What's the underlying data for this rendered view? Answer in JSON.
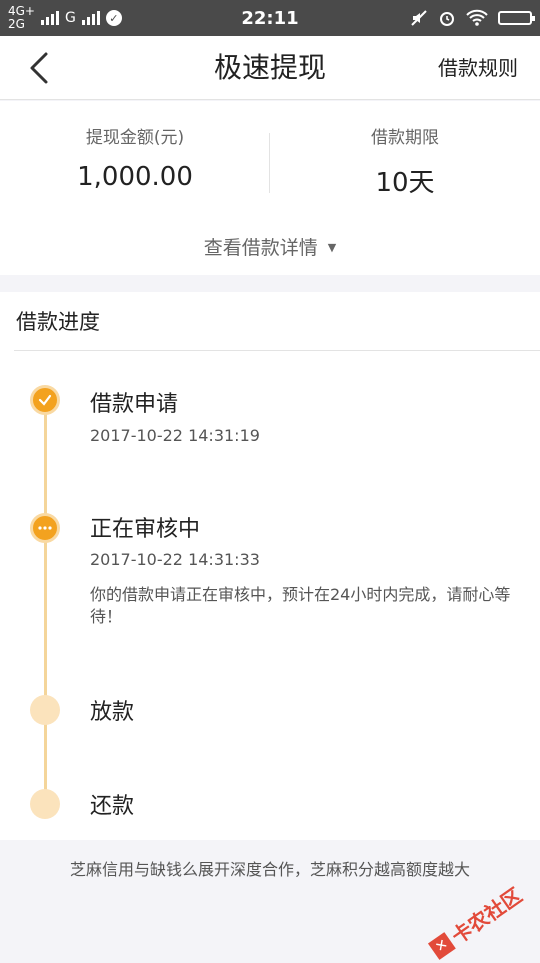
{
  "status_bar": {
    "net_top": "4G+",
    "net_bottom": "2G",
    "carrier": "G",
    "time": "22:11"
  },
  "nav": {
    "title": "极速提现",
    "rules_label": "借款规则"
  },
  "summary": {
    "amount_label": "提现金额(元)",
    "amount_value": "1,000.00",
    "term_label": "借款期限",
    "term_value": "10天",
    "details_link": "查看借款详情"
  },
  "progress": {
    "title": "借款进度",
    "steps": [
      {
        "title": "借款申请",
        "time": "2017-10-22 14:31:19",
        "state": "done"
      },
      {
        "title": "正在审核中",
        "time": "2017-10-22 14:31:33",
        "note": "你的借款申请正在审核中，预计在24小时内完成，请耐心等待！",
        "state": "in-progress"
      },
      {
        "title": "放款",
        "state": "pending"
      },
      {
        "title": "还款",
        "state": "pending"
      }
    ]
  },
  "footer": {
    "text": "芝麻信用与缺钱么展开深度合作，芝麻积分越高额度越大"
  },
  "watermark": {
    "text": "卡农社区"
  },
  "colors": {
    "accent": "#f3a21f",
    "timeline": "#f4d59a",
    "status_bar": "#4a4a4a"
  }
}
